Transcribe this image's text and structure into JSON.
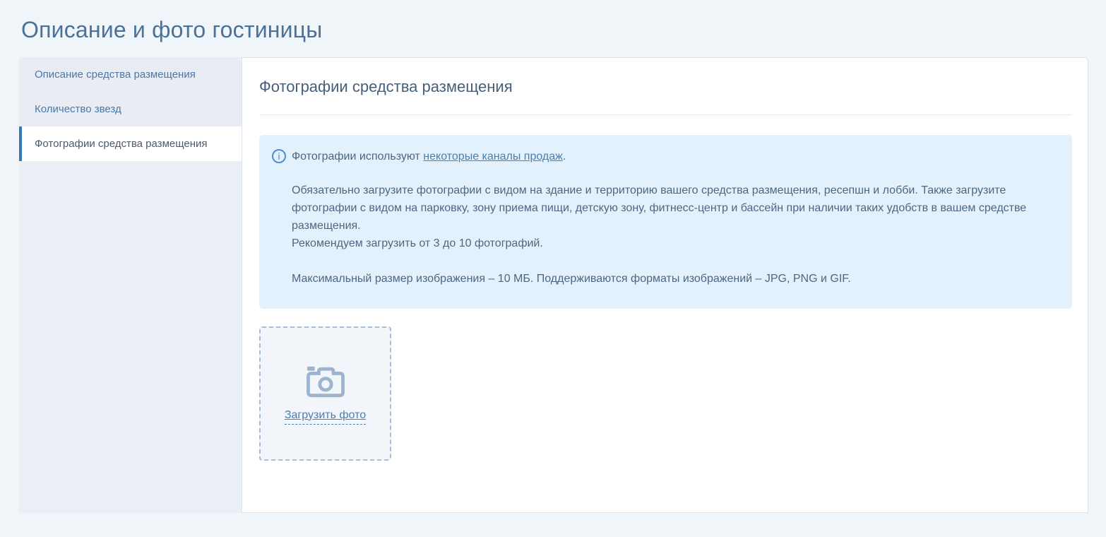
{
  "page": {
    "title": "Описание и фото гостиницы"
  },
  "sidebar": {
    "items": [
      {
        "label": "Описание средства размещения",
        "active": false
      },
      {
        "label": "Количество звезд",
        "active": false
      },
      {
        "label": "Фотографии средства размещения",
        "active": true
      }
    ]
  },
  "main": {
    "heading": "Фотографии средства размещения",
    "info": {
      "intro_prefix": "Фотографии используют ",
      "intro_link": "некоторые каналы продаж",
      "intro_suffix": ".",
      "body_paragraph": "Обязательно загрузите фотографии с видом на здание и территорию вашего средства размещения, ресепшн и лобби. Также загрузите фотографии с видом на парковку, зону приема пищи, детскую зону, фитнесс-центр и бассейн при наличии таких удобств в вашем средстве размещения.",
      "body_recommend": "Рекомендуем загрузить от 3 до 10 фотографий.",
      "body_size": "Максимальный размер изображения – 10 МБ. Поддерживаются форматы изображений – JPG, PNG и GIF."
    },
    "upload": {
      "label": "Загрузить фото"
    }
  },
  "icons": {
    "info_glyph": "i"
  },
  "colors": {
    "accent_blue": "#3779b5",
    "link_blue": "#4a7fae",
    "title_blue": "#4a7298",
    "info_bg": "#e3f1fd",
    "page_bg": "#f0f5f9",
    "camera_icon": "#9cb4ce"
  }
}
